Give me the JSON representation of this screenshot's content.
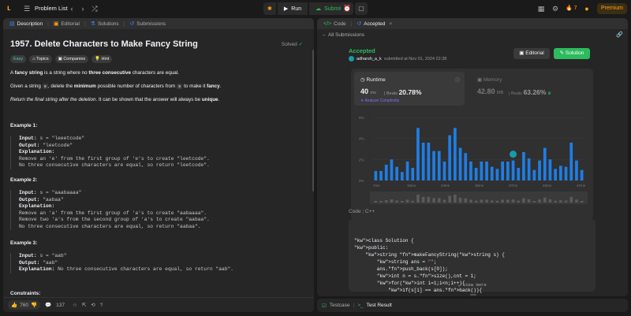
{
  "topnav": {
    "title": "Problem List",
    "run_label": "Run",
    "submit_label": "Submit",
    "streak": "7",
    "premium": "Premium"
  },
  "left_tabs": [
    {
      "label": "Description",
      "icon": "description-icon"
    },
    {
      "label": "Editorial",
      "icon": "editorial-icon"
    },
    {
      "label": "Solutions",
      "icon": "flask-icon"
    },
    {
      "label": "Submissions",
      "icon": "history-icon"
    }
  ],
  "problem": {
    "title": "1957. Delete Characters to Make Fancy String",
    "solved": "Solved",
    "chips": [
      "Easy",
      "Topics",
      "Companies",
      "Hint"
    ],
    "desc1_a": "A ",
    "desc1_b": "fancy string",
    "desc1_c": " is a string where no ",
    "desc1_d": "three consecutive",
    "desc1_e": " characters are equal.",
    "desc2_a": "Given a string ",
    "desc2_s": "s",
    "desc2_b": ", delete the ",
    "desc2_c": "minimum",
    "desc2_d": " possible number of characters from ",
    "desc2_e": " to make it ",
    "desc2_f": "fancy",
    "desc2_g": ".",
    "desc3_a": "Return the final string after the deletion",
    "desc3_b": ". It can be shown that the answer will always be ",
    "desc3_c": "unique",
    "desc3_d": ".",
    "examples": [
      {
        "title": "Example 1:",
        "input": "s = \"leeetcode\"",
        "output": "\"leetcode\"",
        "explanation": [
          "Remove an 'e' from the first group of 'e's to create \"leetcode\".",
          "No three consecutive characters are equal, so return \"leetcode\"."
        ]
      },
      {
        "title": "Example 2:",
        "input": "s = \"aaabaaaa\"",
        "output": "\"aabaa\"",
        "explanation": [
          "Remove an 'a' from the first group of 'a's to create \"aabaaaa\".",
          "Remove two 'a's from the second group of 'a's to create \"aabaa\".",
          "No three consecutive characters are equal, so return \"aabaa\"."
        ]
      },
      {
        "title": "Example 3:",
        "input": "s = \"aab\"",
        "output": "\"aab\"",
        "explanation_inline": "No three consecutive characters are equal, so return \"aab\"."
      }
    ],
    "input_label": "Input:",
    "output_label": "Output:",
    "explanation_label": "Explanation:",
    "constraints": "Constraints:",
    "likes": "760",
    "comments": "137"
  },
  "right_tabs": [
    {
      "label": "Code",
      "icon": "code-icon"
    },
    {
      "label": "Accepted",
      "icon": "accepted-icon"
    }
  ],
  "submission": {
    "back": "All Submissions",
    "status": "Accepted",
    "user": "adharsh_a_k",
    "submitted": "submitted at Nov 01, 2024 22:38",
    "editorial": "Editorial",
    "solution": "Solution",
    "runtime_label": "Runtime",
    "runtime_value": "40",
    "runtime_unit": "ms",
    "beats_label": "Beats",
    "runtime_beats": "20.78%",
    "analyze": "Analyze Complexity",
    "memory_label": "Memory",
    "memory_value": "42.80",
    "memory_unit": "MB",
    "memory_beats": "63.26%",
    "code_label": "Code",
    "lang": "C++",
    "view_more": "View more"
  },
  "bottom_tabs": [
    "Testcase",
    "Test Result"
  ],
  "chart_data": {
    "type": "bar",
    "y_ticks": [
      "6%",
      "4%",
      "2%",
      "0%"
    ],
    "ylim": [
      0,
      6
    ],
    "x_ticks": [
      "7ms",
      "16ms",
      "24ms",
      "30ms",
      "37ms",
      "45ms",
      "47ms"
    ],
    "values": [
      0.9,
      0.9,
      1.5,
      2.0,
      1.3,
      0.8,
      1.8,
      1.2,
      5.0,
      3.6,
      3.6,
      2.8,
      2.8,
      1.8,
      4.3,
      5.0,
      3.1,
      2.6,
      1.8,
      1.2,
      1.8,
      1.8,
      1.3,
      1.1,
      1.8,
      1.8,
      1.9,
      1.2,
      2.7,
      2.1,
      1.0,
      1.9,
      3.1,
      2.0,
      1.1,
      1.4,
      1.3,
      3.6,
      1.9,
      1.0
    ],
    "highlight_index": 26
  },
  "code_lines": [
    "class Solution {",
    "public:",
    "    string makeFancyString(string s) {",
    "        string ans = \"\";",
    "        ans.push_back(s[0]);",
    "        int n = s.size(),cnt = 1;",
    "        for(int i=1;i<n;i++){",
    "            if(s[i] == ans.back()){"
  ]
}
